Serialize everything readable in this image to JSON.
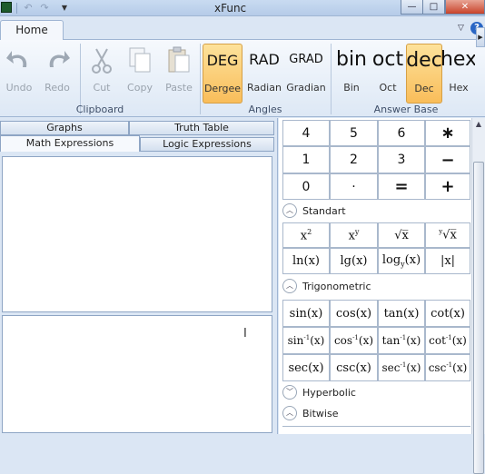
{
  "window": {
    "title": "xFunc",
    "min": "—",
    "max": "□",
    "close": "✕"
  },
  "ribbon": {
    "tab": "Home",
    "help": "?",
    "collapse": "▽",
    "groups": {
      "clipboard": "Clipboard",
      "angles": "Angles",
      "answer_base": "Answer Base"
    },
    "clipboard": {
      "undo": "Undo",
      "redo": "Redo",
      "cut": "Cut",
      "copy": "Copy",
      "paste": "Paste"
    },
    "angles": {
      "deg": {
        "big": "DEG",
        "label": "Dergee"
      },
      "rad": {
        "big": "RAD",
        "label": "Radian"
      },
      "grad": {
        "big": "GRAD",
        "label": "Gradian"
      },
      "selected": "deg"
    },
    "answer_base": {
      "bin": {
        "big": "bin",
        "label": "Bin"
      },
      "oct": {
        "big": "oct",
        "label": "Oct"
      },
      "dec": {
        "big": "dec",
        "label": "Dec"
      },
      "hex": {
        "big": "hex",
        "label": "Hex"
      },
      "selected": "dec"
    }
  },
  "tabs": {
    "graphs": "Graphs",
    "truth_table": "Truth Table",
    "math": "Math Expressions",
    "logic": "Logic Expressions",
    "active": "math"
  },
  "keypad": {
    "rows": [
      [
        "4",
        "5",
        "6",
        "∗"
      ],
      [
        "1",
        "2",
        "3",
        "−"
      ],
      [
        "0",
        "·",
        "=",
        "+"
      ]
    ]
  },
  "sections": {
    "standart": {
      "title": "Standart",
      "collapsed": false
    },
    "trigonometric": {
      "title": "Trigonometric",
      "collapsed": false
    },
    "hyperbolic": {
      "title": "Hyperbolic",
      "collapsed": true
    },
    "bitwise": {
      "title": "Bitwise",
      "collapsed": false
    }
  }
}
